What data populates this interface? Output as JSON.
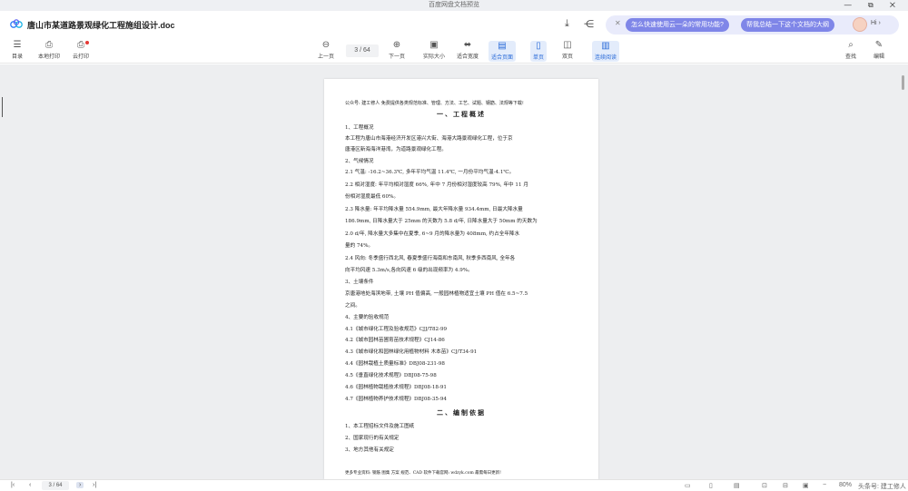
{
  "window": {
    "title": "百度网盘文档预览",
    "controls": "— ⧉ ✕"
  },
  "header": {
    "doc_title": "唐山市某道路景观绿化工程施组设计.doc",
    "ai_bar": {
      "pill1": "怎么快速使用云一朵的常用功能?",
      "pill2": "帮我总结一下这个文档的大纲",
      "greeting": "Hi ›"
    }
  },
  "toolbar": {
    "toc": "目录",
    "local_print": "本地打印",
    "cloud_print": "云打印",
    "prev_page": "上一页",
    "page_indicator": "3 / 64",
    "next_page": "下一页",
    "actual_size": "实际大小",
    "fit_width": "适合宽度",
    "fit_page": "适合页面",
    "single_page": "单页",
    "double_page": "双页",
    "continuous": "连续阅读",
    "search": "查找",
    "edit": "编辑"
  },
  "document": {
    "lines": [
      "公众号: 建工修人 免费提供各类规范标准、管理、方法、工艺、试题、钢筋、法规等下载!",
      "一、工程概述",
      "1、工程概况",
      "    本工程为唐山市海港经济开发区港兴大街、海港大路景观绿化工程，位于京",
      "唐港区新海海洋港湾，为道路景观绿化工程。",
      "  2、气候情况",
      "2.1 气温: -16.2~36.3℃, 多年平均气温 11.4℃, 一月份平均气温-4.1℃。",
      "2.2 相对湿度: 年平均相对湿度 66%, 年中 7 月份相对湿度较高 79%, 年中 11 月",
      "份相对湿度最低 60%。",
      "2.3 降水量: 年平均降水量 554.9mm, 最大年降水量 934.4mm, 日最大降水量",
      "186.9mm, 日降水量大于 25mm 的天数为 5.8 d/年, 日降水量大于 50mm 的天数为",
      "2.0 d/年, 降水量大多集中在夏季, 6~9 月的降水量为 408mm, 约占全年降水",
      "量的 74%。",
      "2.4 风向: 冬季盛行西北风, 春夏季盛行海南和东南风, 秋季多西南风, 全年各",
      "向平均风速 5.3m/s,各向风速 6 级的出现频率为 4.9%。",
      "3、土壤条件",
      "京唐港地处海滨地带, 土壤 PH 值偏高, 一般园林植物适宜土壤 PH 值在 6.5~7.5",
      "之间。",
      "4、主要的验收规范",
      "4.1《城市绿化工程及验收规范》CJJ/T82-99",
      "4.2《城市园林苗圃育苗技术规程》CJ14-86",
      "4.3《城市绿化和园林绿化用植物材料  木本苗》CJ/T34-91",
      "4.4《园林栽植土质量标准》DBJ08-231-98",
      "4.5《垂直绿化技术规程》DBJ08-75-98",
      "4.6《园林植物栽植技术规程》DBJ08-18-91",
      "4.7《园林植物养护技术规程》DBJ08-35-94",
      "二、编制依据",
      "1、本工程招标文件及施工图纸",
      "2、国家现行的有关规定",
      "3、地方其他有关规定",
      "更多专业资料: 钢筋 图集 方案 规范、CAD 软件下载官网: wdzyk.com 最需每日更新!"
    ]
  },
  "statusbar": {
    "page": "3 / 64",
    "zoom": "80%",
    "watermark": "头条号: 建工修人"
  }
}
